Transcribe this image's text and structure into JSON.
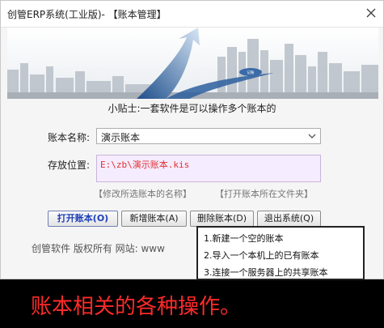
{
  "window": {
    "title": "创管ERP系统(工业版)- 【账本管理】"
  },
  "banner": {
    "badge": "记账"
  },
  "tip": "小贴士:一套软件是可以操作多个账本的",
  "form": {
    "name_label": "账本名称:",
    "name_value": "演示账本",
    "path_label": "存放位置:",
    "path_value": "E:\\zb\\演示账本.kis"
  },
  "links": {
    "rename": "【修改所选账本的名称】",
    "open_folder": "【打开账本所在文件夹】"
  },
  "buttons": {
    "open": "打开账本(O)",
    "new": "新增账本(A)",
    "delete": "删除账本(D)",
    "exit": "退出系统(Q)"
  },
  "footer": "创管软件 版权所有 网站: www",
  "menu": {
    "items": [
      "1.新建一个空的账本",
      "2.导入一个本机上的已有账本",
      "3.连接一个服务器上的共享账本"
    ]
  },
  "caption": "账本相关的各种操作。",
  "colors": {
    "caption": "#ff2a2a",
    "path_text": "#e03030",
    "path_bg": "#f6ecff",
    "primary_button_text": "#1d3fb8"
  }
}
